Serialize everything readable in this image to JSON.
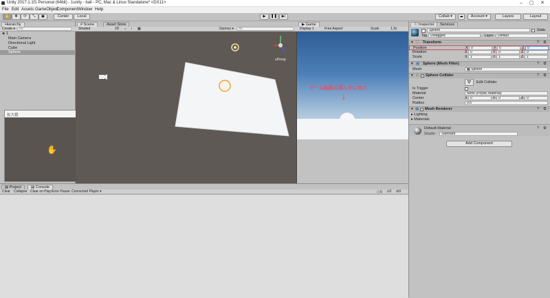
{
  "title": "Unity 2017.1.1f1 Personal (64bit) - 1unity - ball - PC, Mac & Linux Standalone* <DX11>",
  "window_controls": {
    "minimize": "–",
    "maximize": "▢",
    "close": "✕"
  },
  "menu": [
    "File",
    "Edit",
    "Assets",
    "GameObject",
    "Component",
    "Window",
    "Help"
  ],
  "toolbar": {
    "pivot": "Center",
    "space": "Local",
    "collab": "Collab ▾",
    "account": "Account ▾",
    "layers": "Layers",
    "layout": "Layout"
  },
  "hierarchy": {
    "tab": "Hierarchy",
    "create": "Create ▾",
    "search_placeholder": "All",
    "scene_name": "1",
    "items": [
      "Main Camera",
      "Directional Light",
      "Cube",
      "Sphere"
    ],
    "selected": "Sphere"
  },
  "floating_window": {
    "title": "拡大鏡"
  },
  "scene": {
    "tabs": [
      "Scene",
      "Asset Store"
    ],
    "shading": "Shaded",
    "mode_2d": "2D",
    "gizmos": "Gizmos ▾",
    "search_placeholder": "All",
    "persp_label": "≤Persp"
  },
  "game": {
    "tab": "Game",
    "display": "Display 1",
    "aspect": "Free Aspect",
    "scale_label": "Scale",
    "scale_value": "1.3x",
    "annotation": "ゲーム画面の真ん中に来た",
    "arrow": "↓"
  },
  "inspector": {
    "tabs": [
      "Inspector",
      "Services"
    ],
    "object_name": "Sphere",
    "static_label": "Static",
    "tag_label": "Tag",
    "tag_value": "Untagged",
    "layer_label": "Layer",
    "layer_value": "Default",
    "transform": {
      "title": "Transform",
      "rows": [
        {
          "label": "Position",
          "x": "0",
          "y": "0",
          "z": "0"
        },
        {
          "label": "Rotation",
          "x": "0",
          "y": "0",
          "z": "0"
        },
        {
          "label": "Scale",
          "x": "1",
          "y": "1",
          "z": "1"
        }
      ]
    },
    "mesh_filter": {
      "title": "Sphere (Mesh Filter)",
      "mesh_label": "Mesh",
      "mesh_value": "Sphere"
    },
    "sphere_collider": {
      "title": "Sphere Collider",
      "edit_label": "Edit Collider",
      "is_trigger_label": "Is Trigger",
      "material_label": "Material",
      "material_value": "None (Physic Material)",
      "center_label": "Center",
      "center": {
        "x": "0",
        "y": "0",
        "z": "0"
      },
      "radius_label": "Radius",
      "radius_value": "0.5"
    },
    "mesh_renderer": {
      "title": "Mesh Renderer",
      "lighting": "Lighting",
      "materials": "Materials"
    },
    "material": {
      "name": "Default-Material",
      "shader_label": "Shader",
      "shader_value": "Standard"
    },
    "add_component": "Add Component"
  },
  "console": {
    "tabs": [
      "Project",
      "Console"
    ],
    "buttons": [
      "Clear",
      "Collapse",
      "Clear on Play",
      "Error Pause",
      "Connected Player ▾"
    ],
    "counts": [
      "0",
      "0",
      "0"
    ]
  },
  "axis_labels": {
    "x": "X",
    "y": "Y",
    "z": "Z"
  }
}
